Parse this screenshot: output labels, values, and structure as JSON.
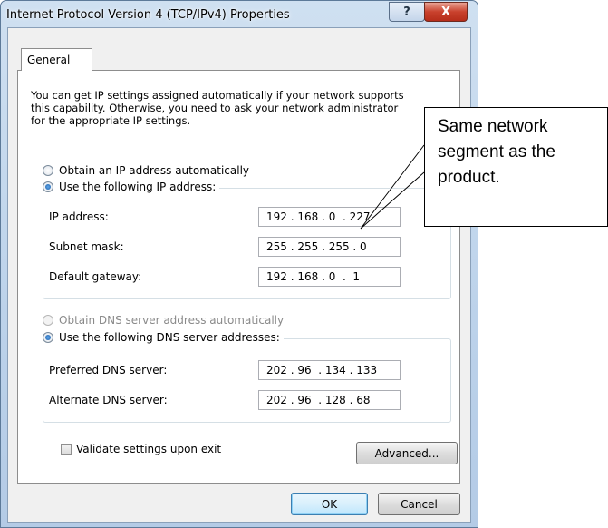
{
  "window": {
    "title": "Internet Protocol Version 4 (TCP/IPv4) Properties",
    "help_glyph": "?",
    "close_glyph": "X"
  },
  "tabs": [
    {
      "label": "General"
    }
  ],
  "description": "You can get IP settings assigned automatically if your network supports\nthis capability. Otherwise, you need to ask your network administrator\nfor the appropriate IP settings.",
  "ip_section": {
    "auto_label": "Obtain an IP address automatically",
    "manual_label": "Use the following IP address:",
    "selected": "manual",
    "fields": [
      {
        "label": "IP address:",
        "value": "192 . 168 . 0  . 227"
      },
      {
        "label": "Subnet mask:",
        "value": "255 . 255 . 255 . 0"
      },
      {
        "label": "Default gateway:",
        "value": "192 . 168 . 0  .  1"
      }
    ]
  },
  "dns_section": {
    "auto_label": "Obtain DNS server address automatically",
    "manual_label": "Use the following DNS server addresses:",
    "selected": "manual",
    "auto_disabled": true,
    "fields": [
      {
        "label": "Preferred DNS server:",
        "value": "202 . 96  . 134 . 133"
      },
      {
        "label": "Alternate DNS server:",
        "value": "202 . 96  . 128 . 68"
      }
    ]
  },
  "validate": {
    "label": "Validate settings upon exit",
    "checked": false
  },
  "buttons": {
    "advanced": "Advanced...",
    "ok": "OK",
    "cancel": "Cancel"
  },
  "annotation": {
    "text": "Same network\nsegment as the\nproduct."
  }
}
